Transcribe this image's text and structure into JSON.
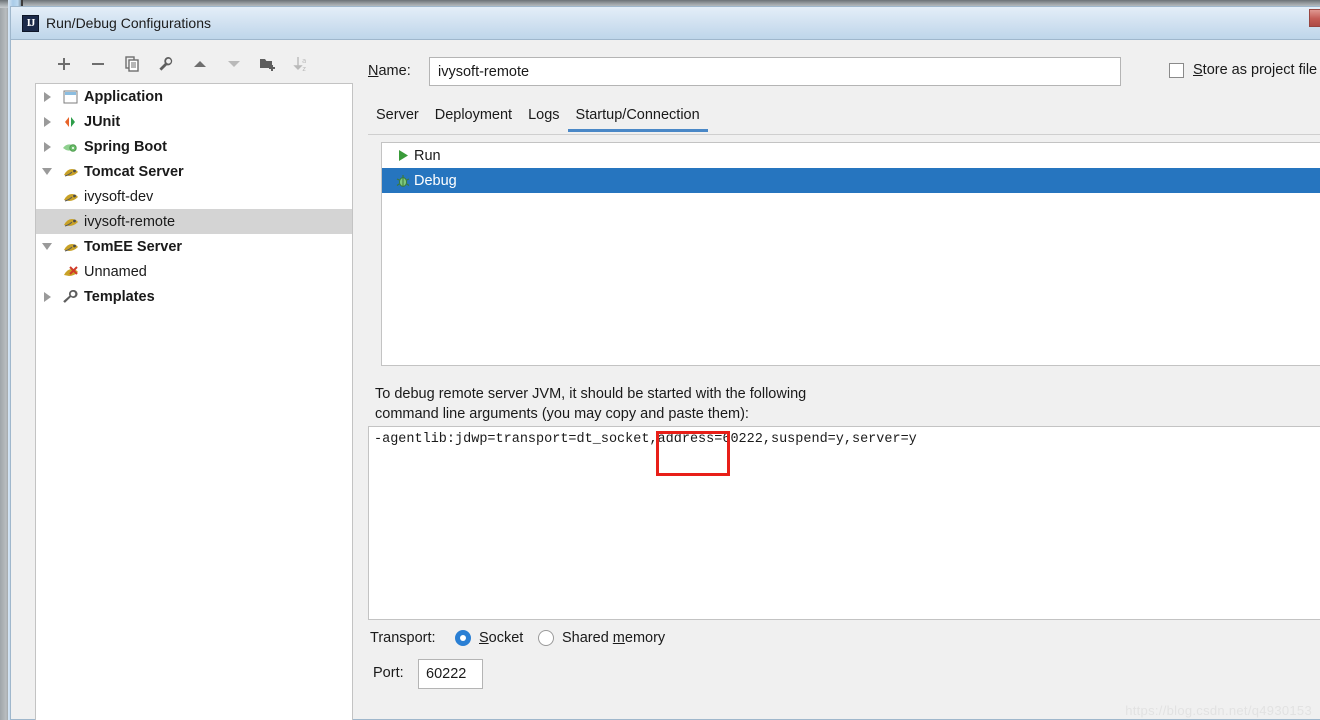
{
  "window": {
    "title": "Run/Debug Configurations",
    "app_icon": "IJ",
    "icon_name": "intellij-idea-icon",
    "close_button": "close-icon"
  },
  "toolbar": {
    "buttons": [
      {
        "name": "add-configuration-button",
        "icon": "plus-icon",
        "enabled": true
      },
      {
        "name": "remove-configuration-button",
        "icon": "minus-icon",
        "enabled": true
      },
      {
        "name": "copy-configuration-button",
        "icon": "copy-icon",
        "enabled": true
      },
      {
        "name": "edit-templates-button",
        "icon": "wrench-icon",
        "enabled": true
      },
      {
        "name": "move-up-button",
        "icon": "arrow-up-icon",
        "enabled": true
      },
      {
        "name": "move-down-button",
        "icon": "arrow-down-icon",
        "enabled": false
      },
      {
        "name": "new-folder-button",
        "icon": "folder-add-icon",
        "enabled": true
      },
      {
        "name": "sort-alphabetically-button",
        "icon": "sort-az-icon",
        "enabled": false
      }
    ]
  },
  "tree": {
    "items": [
      {
        "label": "Application",
        "icon": "application-icon",
        "level": 0,
        "expanded": false,
        "bold": true,
        "selected": false
      },
      {
        "label": "JUnit",
        "icon": "junit-icon",
        "level": 0,
        "expanded": false,
        "bold": true,
        "selected": false
      },
      {
        "label": "Spring Boot",
        "icon": "spring-boot-icon",
        "level": 0,
        "expanded": false,
        "bold": true,
        "selected": false
      },
      {
        "label": "Tomcat Server",
        "icon": "tomcat-icon",
        "level": 0,
        "expanded": true,
        "bold": true,
        "selected": false
      },
      {
        "label": "ivysoft-dev",
        "icon": "tomcat-icon",
        "level": 1,
        "expanded": null,
        "bold": false,
        "selected": false
      },
      {
        "label": "ivysoft-remote",
        "icon": "tomcat-icon",
        "level": 1,
        "expanded": null,
        "bold": false,
        "selected": true
      },
      {
        "label": "TomEE Server",
        "icon": "tomee-icon",
        "level": 0,
        "expanded": true,
        "bold": true,
        "selected": false
      },
      {
        "label": "Unnamed",
        "icon": "tomee-invalid-icon",
        "level": 1,
        "expanded": null,
        "bold": false,
        "selected": false
      },
      {
        "label": "Templates",
        "icon": "wrench-icon",
        "level": 0,
        "expanded": false,
        "bold": true,
        "selected": false
      }
    ]
  },
  "form": {
    "name_label_prefix": "N",
    "name_label_rest": "ame:",
    "name_value": "ivysoft-remote",
    "name_placeholder": "",
    "store_as_project_file_prefix": "S",
    "store_as_project_file_rest": "tore as project file",
    "store_as_project_file_checked": false
  },
  "tabs": [
    {
      "label": "Server",
      "active": false
    },
    {
      "label": "Deployment",
      "active": false
    },
    {
      "label": "Logs",
      "active": false
    },
    {
      "label": "Startup/Connection",
      "active": true
    }
  ],
  "launch_list": {
    "rows": [
      {
        "label": "Run",
        "icon": "run-play-icon",
        "selected": false
      },
      {
        "label": "Debug",
        "icon": "debug-bug-icon",
        "selected": true
      }
    ]
  },
  "hint": {
    "line1": "To debug remote server JVM, it should be started with the following",
    "line2": "command line arguments (you may copy and paste them):"
  },
  "args": {
    "text": "-agentlib:jdwp=transport=dt_socket,address=60222,suspend=y,server=y"
  },
  "annotation": {
    "color": "#e81f18",
    "name": "address-port-highlight-box"
  },
  "transport": {
    "label": "Transport:",
    "options": [
      {
        "label_prefix": "S",
        "label_rest": "ocket",
        "selected": true
      },
      {
        "label_prefix": "Shared ",
        "label_mnemonic": "m",
        "label_rest": "emory",
        "selected": false
      }
    ],
    "socket_label_prefix": "S",
    "socket_label_rest": "ocket",
    "shared_label_a": "Shared ",
    "shared_label_m": "m",
    "shared_label_b": "emory"
  },
  "port": {
    "label": "Port:",
    "value": "60222"
  },
  "watermark": {
    "text": "https://blog.csdn.net/q4930153"
  },
  "colors": {
    "selection_blue": "#2675bf",
    "tab_underline": "#4a88c7",
    "tree_selection": "#d4d4d4",
    "annotation_red": "#e81f18",
    "dialog_bg": "#f0f0f0"
  }
}
